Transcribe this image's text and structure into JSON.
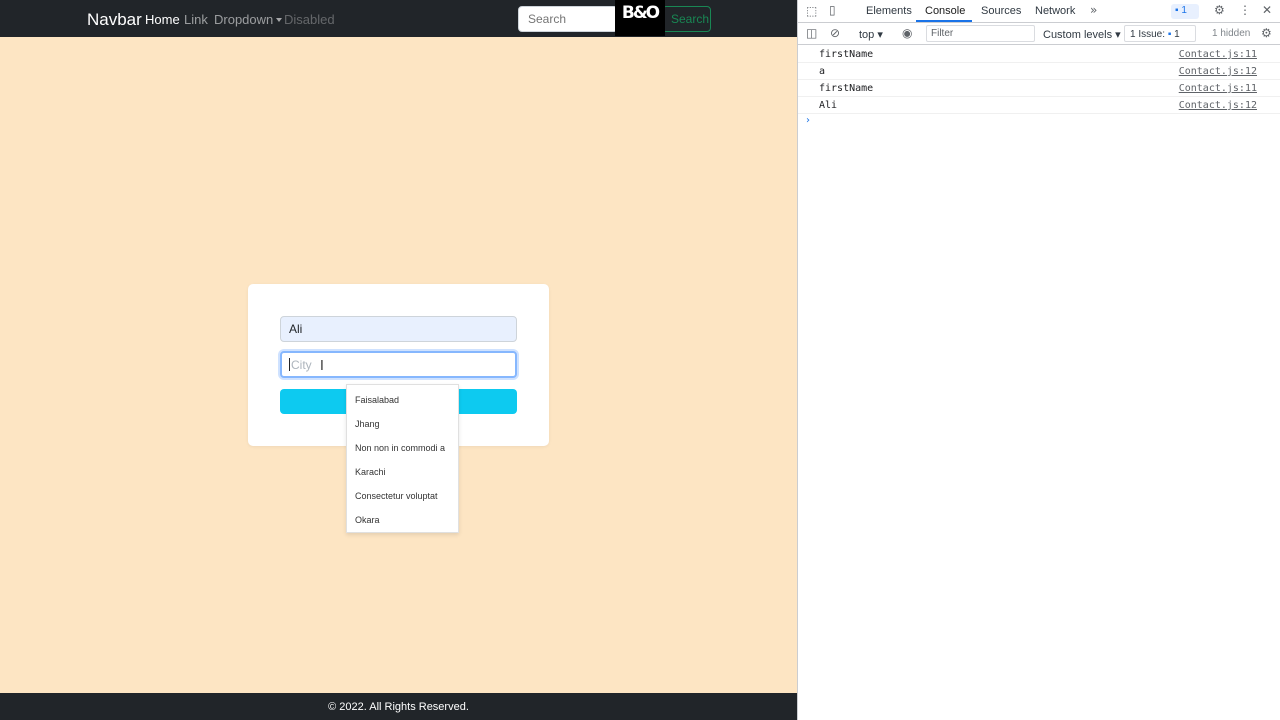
{
  "navbar": {
    "brand": "Navbar",
    "links": [
      "Home",
      "Link",
      "Dropdown",
      "Disabled"
    ],
    "search_placeholder": "Search",
    "search_button": "Search",
    "logo_text": "B&O"
  },
  "form": {
    "first_name_value": "Ali",
    "city_placeholder": "City",
    "suggestions": [
      "Faisalabad",
      "Jhang",
      "Non non in commodi a",
      "Karachi",
      "Consectetur voluptat",
      "Okara"
    ]
  },
  "footer": {
    "text": "© 2022. All Rights Reserved."
  },
  "devtools": {
    "tabs": [
      "Elements",
      "Console",
      "Sources",
      "Network"
    ],
    "active_tab": "Console",
    "more_tabs_icon": "»",
    "message_badge": "1",
    "context": "top",
    "filter_placeholder": "Filter",
    "levels": "Custom levels",
    "issues_label": "1 Issue:",
    "issues_count": "1",
    "hidden": "1 hidden",
    "logs": [
      {
        "message": "firstName",
        "source": "Contact.js:11"
      },
      {
        "message": "a",
        "source": "Contact.js:12"
      },
      {
        "message": "firstName",
        "source": "Contact.js:11"
      },
      {
        "message": "Ali",
        "source": "Contact.js:12"
      }
    ],
    "prompt": "›"
  },
  "colors": {
    "page_background": "#fde5c3",
    "navbar_background": "#212529",
    "submit_button": "#0dcaf0",
    "devtools_accent": "#1a73e8"
  }
}
